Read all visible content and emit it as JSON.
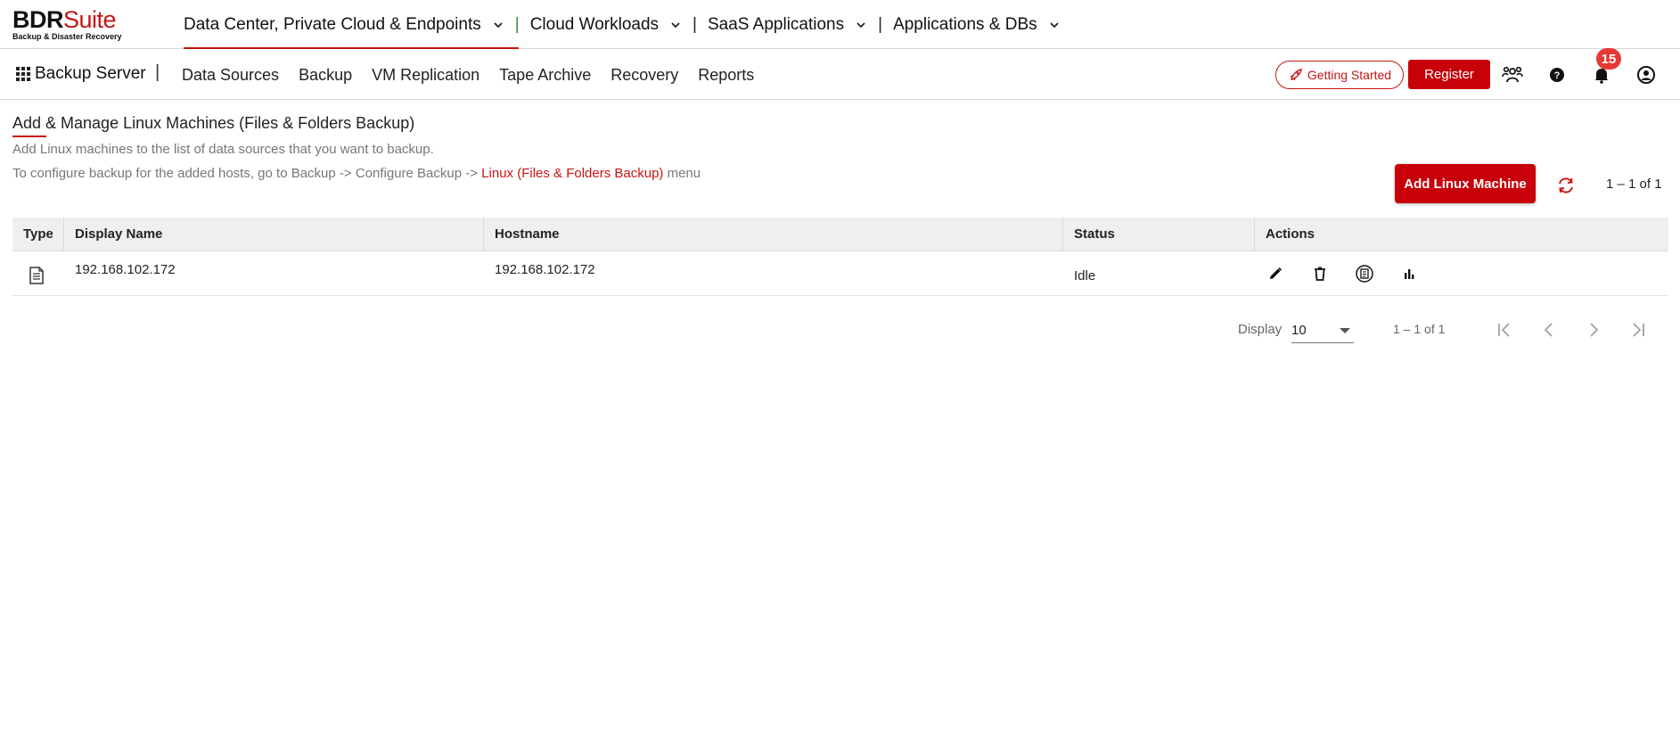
{
  "brand": {
    "name_part1": "BDR",
    "name_part2": "Suite",
    "tagline": "Backup & Disaster Recovery",
    "accent_color": "#c81414"
  },
  "top_nav": {
    "items": [
      {
        "label": "Data Center, Private Cloud & Endpoints",
        "active": true
      },
      {
        "label": "Cloud Workloads",
        "active": false
      },
      {
        "label": "SaaS Applications",
        "active": false
      },
      {
        "label": "Applications & DBs",
        "active": false
      }
    ],
    "separator": "|"
  },
  "sub_nav": {
    "app_name": "Backup Server",
    "separator": "|",
    "items": [
      "Data Sources",
      "Backup",
      "VM Replication",
      "Tape Archive",
      "Recovery",
      "Reports"
    ],
    "getting_started": "Getting Started",
    "register": "Register",
    "notification_count": "15",
    "icons": [
      "community-icon",
      "help-icon",
      "bell-icon",
      "user-account-icon"
    ]
  },
  "page": {
    "title": "Add & Manage Linux Machines (Files & Folders Backup)",
    "description": "Add Linux machines to the list of data sources that you want to backup.",
    "config_hint_prefix": "To configure backup for the added hosts, go to Backup -> Configure Backup -> ",
    "config_hint_link": "Linux (Files & Folders Backup)",
    "config_hint_suffix": " menu",
    "add_button": "Add Linux Machine",
    "range_summary": "1 – 1 of 1"
  },
  "table": {
    "columns": [
      "Type",
      "Display Name",
      "Hostname",
      "Status",
      "Actions"
    ],
    "rows": [
      {
        "type_icon": "document-icon",
        "display_name": "192.168.102.172",
        "hostname": "192.168.102.172",
        "status": "Idle",
        "actions": [
          "edit-icon",
          "delete-icon",
          "backup-history-icon",
          "report-chart-icon"
        ]
      }
    ]
  },
  "pagination": {
    "display_label": "Display",
    "page_size": "10",
    "range": "1 – 1 of 1"
  }
}
